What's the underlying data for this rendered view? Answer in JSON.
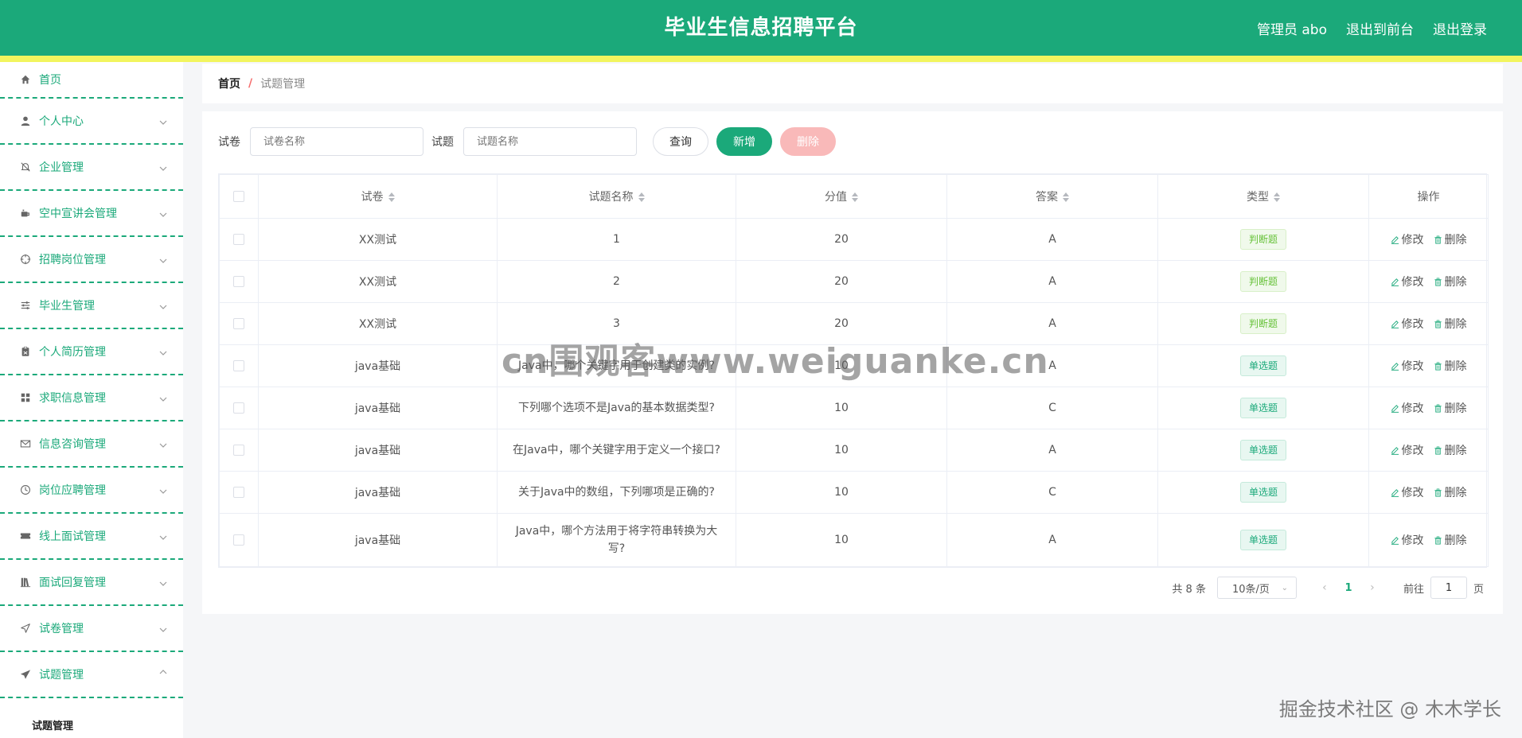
{
  "header": {
    "title": "毕业生信息招聘平台",
    "links": [
      "管理员 abo",
      "退出到前台",
      "退出登录"
    ]
  },
  "sidebar": {
    "items": [
      {
        "label": "首页",
        "icon": "home-icon",
        "expandable": false
      },
      {
        "label": "个人中心",
        "icon": "user-icon",
        "expandable": true
      },
      {
        "label": "企业管理",
        "icon": "bell-off-icon",
        "expandable": true
      },
      {
        "label": "空中宣讲会管理",
        "icon": "coffee-cup-icon",
        "expandable": true
      },
      {
        "label": "招聘岗位管理",
        "icon": "crosshair-icon",
        "expandable": true
      },
      {
        "label": "毕业生管理",
        "icon": "sliders-icon",
        "expandable": true
      },
      {
        "label": "个人简历管理",
        "icon": "clipboard-icon",
        "expandable": true
      },
      {
        "label": "求职信息管理",
        "icon": "grid-icon",
        "expandable": true
      },
      {
        "label": "信息咨询管理",
        "icon": "mail-icon",
        "expandable": true
      },
      {
        "label": "岗位应聘管理",
        "icon": "clock-icon",
        "expandable": true
      },
      {
        "label": "线上面试管理",
        "icon": "ticket-icon",
        "expandable": true
      },
      {
        "label": "面试回复管理",
        "icon": "books-icon",
        "expandable": true
      },
      {
        "label": "试卷管理",
        "icon": "send-icon",
        "expandable": true
      },
      {
        "label": "试题管理",
        "icon": "paper-plane-icon",
        "expandable": true,
        "open": true
      }
    ],
    "sub_item": "试题管理"
  },
  "breadcrumb": {
    "home": "首页",
    "separator": "/",
    "current": "试题管理"
  },
  "search": {
    "paper_label": "试卷",
    "paper_placeholder": "试卷名称",
    "question_label": "试题",
    "question_placeholder": "试题名称",
    "query_button": "查询",
    "add_button": "新增",
    "delete_button": "删除"
  },
  "table": {
    "headers": [
      "试卷",
      "试题名称",
      "分值",
      "答案",
      "类型",
      "操作"
    ],
    "edit_label": "修改",
    "delete_label": "删除",
    "rows": [
      {
        "paper": "XX测试",
        "name": "1",
        "score": "20",
        "answer": "A",
        "type": "判断题",
        "type_style": "judge"
      },
      {
        "paper": "XX测试",
        "name": "2",
        "score": "20",
        "answer": "A",
        "type": "判断题",
        "type_style": "judge"
      },
      {
        "paper": "XX测试",
        "name": "3",
        "score": "20",
        "answer": "A",
        "type": "判断题",
        "type_style": "judge"
      },
      {
        "paper": "java基础",
        "name": "Java中，哪个关键字用于创建类的实例?",
        "score": "10",
        "answer": "A",
        "type": "单选题",
        "type_style": "single"
      },
      {
        "paper": "java基础",
        "name": "下列哪个选项不是Java的基本数据类型?",
        "score": "10",
        "answer": "C",
        "type": "单选题",
        "type_style": "single"
      },
      {
        "paper": "java基础",
        "name": "在Java中，哪个关键字用于定义一个接口?",
        "score": "10",
        "answer": "A",
        "type": "单选题",
        "type_style": "single"
      },
      {
        "paper": "java基础",
        "name": "关于Java中的数组，下列哪项是正确的?",
        "score": "10",
        "answer": "C",
        "type": "单选题",
        "type_style": "single"
      },
      {
        "paper": "java基础",
        "name": "Java中，哪个方法用于将字符串转换为大写?",
        "score": "10",
        "answer": "A",
        "type": "单选题",
        "type_style": "single",
        "tall": true
      }
    ]
  },
  "pagination": {
    "total": "共 8 条",
    "page_size": "10条/页",
    "current_page": "1",
    "goto_label": "前往",
    "goto_value": "1",
    "goto_suffix": "页"
  },
  "watermarks": {
    "center": "cn围观客www.weiguanke.cn",
    "corner": "掘金技术社区 @ 木木学长"
  },
  "colors": {
    "primary": "#1ba97a",
    "header_stripe": "#f2f55e",
    "danger_light": "#f9b9b9",
    "judge_tag": "#67c23a"
  }
}
